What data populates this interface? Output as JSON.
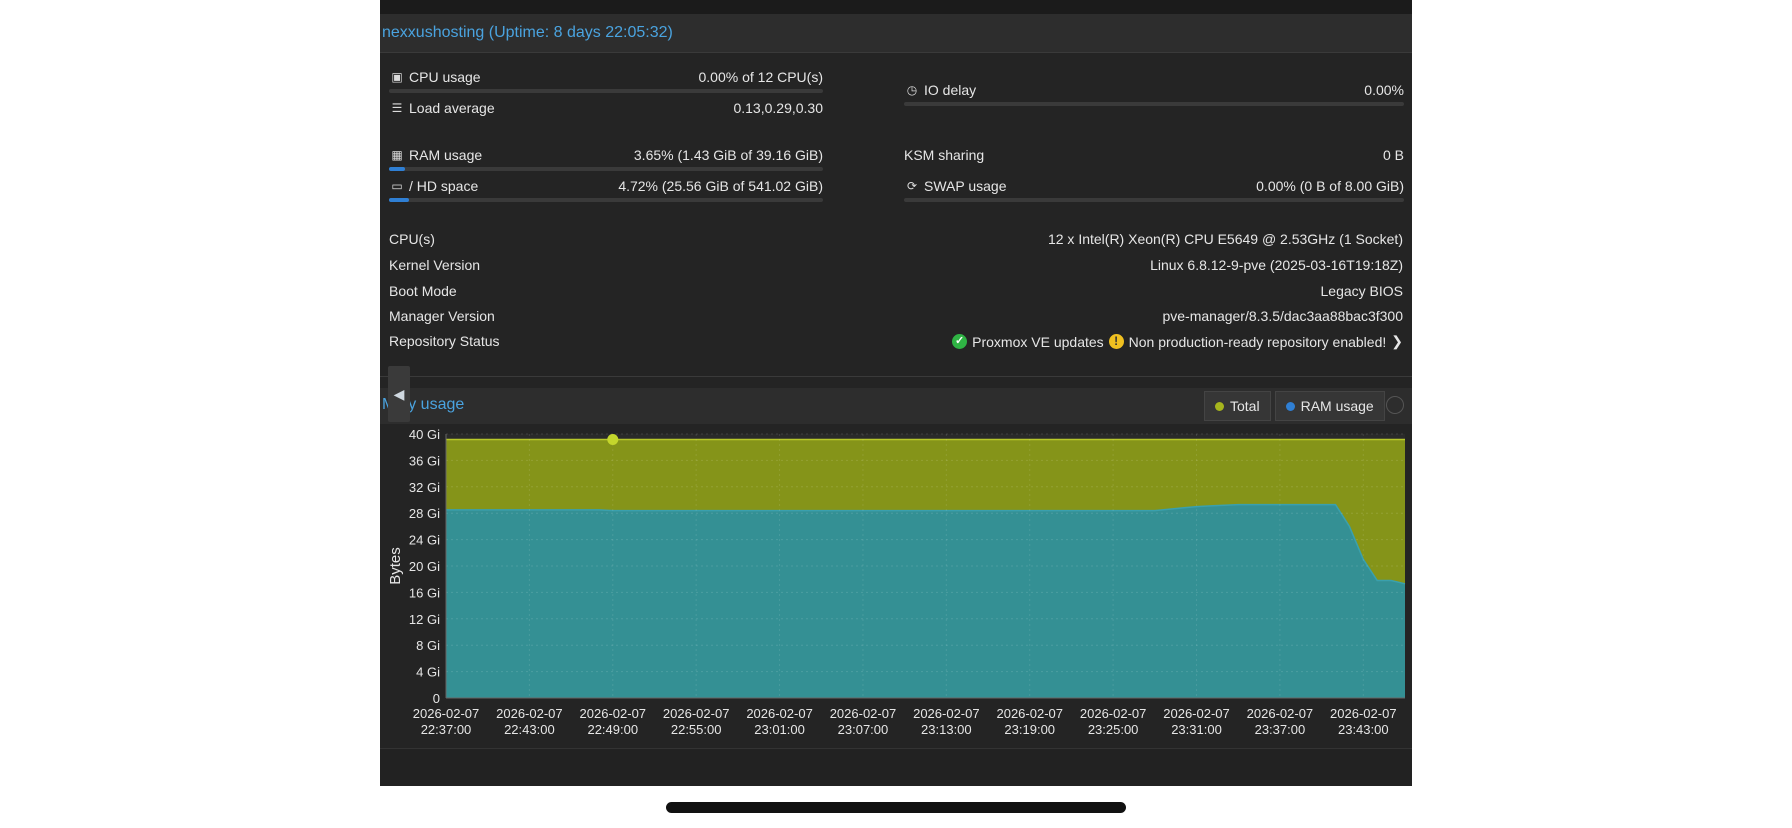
{
  "header": {
    "title": "nexxushosting (Uptime: 8 days 22:05:32)"
  },
  "metrics": {
    "cpu": {
      "label": "CPU usage",
      "value": "0.00% of 12 CPU(s)",
      "percent": 0.0,
      "icon": "cpu-icon"
    },
    "io": {
      "label": "IO delay",
      "value": "0.00%",
      "percent": 0.0,
      "icon": "clock-icon"
    },
    "load": {
      "label": "Load average",
      "value": "0.13,0.29,0.30",
      "icon": "list-icon"
    },
    "ram": {
      "label": "RAM usage",
      "value": "3.65% (1.43 GiB of 39.16 GiB)",
      "percent": 3.65,
      "icon": "memory-icon"
    },
    "ksm": {
      "label": "KSM sharing",
      "value": "0 B"
    },
    "hd": {
      "label": "/ HD space",
      "value": "4.72% (25.56 GiB of 541.02 GiB)",
      "percent": 4.72,
      "icon": "hdd-icon"
    },
    "swap": {
      "label": "SWAP usage",
      "value": "0.00% (0 B of 8.00 GiB)",
      "percent": 0.0,
      "icon": "refresh-icon"
    }
  },
  "info": [
    {
      "key": "CPU(s)",
      "value": "12 x Intel(R) Xeon(R) CPU E5649 @ 2.53GHz (1 Socket)"
    },
    {
      "key": "Kernel Version",
      "value": "Linux 6.8.12-9-pve (2025-03-16T19:18Z)"
    },
    {
      "key": "Boot Mode",
      "value": "Legacy BIOS"
    },
    {
      "key": "Manager Version",
      "value": "pve-manager/8.3.5/dac3aa88bac3f300"
    }
  ],
  "repo": {
    "key": "Repository Status",
    "ok_text": "Proxmox VE updates",
    "warn_text": "Non production-ready repository enabled!"
  },
  "memory": {
    "title": "ory usage",
    "title_initial": "M",
    "legend": [
      {
        "name": "Total",
        "color": "#a6b51d"
      },
      {
        "name": "RAM usage",
        "color": "#2f7fd4"
      }
    ]
  },
  "colors": {
    "accent": "#4aa3df",
    "total_fill": "#8a9a18",
    "ram_fill": "#2f8f9b",
    "bar_fill": "#2f7fd4"
  },
  "chart_data": {
    "type": "area",
    "ylabel": "Bytes",
    "ylim": [
      0,
      40
    ],
    "yticks": [
      "0",
      "4 Gi",
      "8 Gi",
      "12 Gi",
      "16 Gi",
      "20 Gi",
      "24 Gi",
      "28 Gi",
      "32 Gi",
      "36 Gi",
      "40 Gi"
    ],
    "yvalues": [
      0,
      4,
      8,
      12,
      16,
      20,
      24,
      28,
      32,
      36,
      40
    ],
    "x": [
      "2026-02-07 22:37:00",
      "2026-02-07 22:38:00",
      "2026-02-07 22:39:00",
      "2026-02-07 22:40:00",
      "2026-02-07 22:41:00",
      "2026-02-07 22:42:00",
      "2026-02-07 22:43:00",
      "2026-02-07 22:44:00",
      "2026-02-07 22:45:00",
      "2026-02-07 22:46:00",
      "2026-02-07 22:47:00",
      "2026-02-07 22:48:00",
      "2026-02-07 22:49:00",
      "2026-02-07 22:50:00",
      "2026-02-07 22:51:00",
      "2026-02-07 22:52:00",
      "2026-02-07 22:53:00",
      "2026-02-07 22:54:00",
      "2026-02-07 22:55:00",
      "2026-02-07 22:56:00",
      "2026-02-07 22:57:00",
      "2026-02-07 22:58:00",
      "2026-02-07 22:59:00",
      "2026-02-07 23:00:00",
      "2026-02-07 23:01:00",
      "2026-02-07 23:02:00",
      "2026-02-07 23:03:00",
      "2026-02-07 23:04:00",
      "2026-02-07 23:05:00",
      "2026-02-07 23:06:00",
      "2026-02-07 23:07:00",
      "2026-02-07 23:08:00",
      "2026-02-07 23:09:00",
      "2026-02-07 23:10:00",
      "2026-02-07 23:11:00",
      "2026-02-07 23:12:00",
      "2026-02-07 23:13:00",
      "2026-02-07 23:14:00",
      "2026-02-07 23:15:00",
      "2026-02-07 23:16:00",
      "2026-02-07 23:17:00",
      "2026-02-07 23:18:00",
      "2026-02-07 23:19:00",
      "2026-02-07 23:20:00",
      "2026-02-07 23:21:00",
      "2026-02-07 23:22:00",
      "2026-02-07 23:23:00",
      "2026-02-07 23:24:00",
      "2026-02-07 23:25:00",
      "2026-02-07 23:26:00",
      "2026-02-07 23:27:00",
      "2026-02-07 23:28:00",
      "2026-02-07 23:29:00",
      "2026-02-07 23:30:00",
      "2026-02-07 23:31:00",
      "2026-02-07 23:32:00",
      "2026-02-07 23:33:00",
      "2026-02-07 23:34:00",
      "2026-02-07 23:35:00",
      "2026-02-07 23:36:00",
      "2026-02-07 23:37:00",
      "2026-02-07 23:38:00",
      "2026-02-07 23:39:00",
      "2026-02-07 23:40:00",
      "2026-02-07 23:41:00",
      "2026-02-07 23:42:00",
      "2026-02-07 23:43:00",
      "2026-02-07 23:44:00",
      "2026-02-07 23:45:00",
      "2026-02-07 23:46:00"
    ],
    "xtick_labels": [
      [
        "2026-02-07",
        "22:37:00"
      ],
      [
        "2026-02-07",
        "22:43:00"
      ],
      [
        "2026-02-07",
        "22:49:00"
      ],
      [
        "2026-02-07",
        "22:55:00"
      ],
      [
        "2026-02-07",
        "23:01:00"
      ],
      [
        "2026-02-07",
        "23:07:00"
      ],
      [
        "2026-02-07",
        "23:13:00"
      ],
      [
        "2026-02-07",
        "23:19:00"
      ],
      [
        "2026-02-07",
        "23:25:00"
      ],
      [
        "2026-02-07",
        "23:31:00"
      ],
      [
        "2026-02-07",
        "23:37:00"
      ],
      [
        "2026-02-07",
        "23:43:00"
      ]
    ],
    "series": [
      {
        "name": "Total",
        "values": [
          39.16,
          39.16,
          39.16,
          39.16,
          39.16,
          39.16,
          39.16,
          39.16,
          39.16,
          39.16,
          39.16,
          39.16,
          39.16,
          39.16,
          39.16,
          39.16,
          39.16,
          39.16,
          39.16,
          39.16,
          39.16,
          39.16,
          39.16,
          39.16,
          39.16,
          39.16,
          39.16,
          39.16,
          39.16,
          39.16,
          39.16,
          39.16,
          39.16,
          39.16,
          39.16,
          39.16,
          39.16,
          39.16,
          39.16,
          39.16,
          39.16,
          39.16,
          39.16,
          39.16,
          39.16,
          39.16,
          39.16,
          39.16,
          39.16,
          39.16,
          39.16,
          39.16,
          39.16,
          39.16,
          39.16,
          39.16,
          39.16,
          39.16,
          39.16,
          39.16,
          39.16,
          39.16,
          39.16,
          39.16,
          39.16,
          39.16,
          39.16,
          39.16,
          39.16,
          39.16
        ]
      },
      {
        "name": "RAM usage",
        "values": [
          28.5,
          28.5,
          28.5,
          28.5,
          28.5,
          28.5,
          28.5,
          28.5,
          28.5,
          28.5,
          28.5,
          28.5,
          28.4,
          28.4,
          28.4,
          28.4,
          28.4,
          28.4,
          28.4,
          28.4,
          28.4,
          28.4,
          28.4,
          28.4,
          28.4,
          28.4,
          28.4,
          28.4,
          28.4,
          28.4,
          28.4,
          28.4,
          28.4,
          28.4,
          28.4,
          28.4,
          28.4,
          28.4,
          28.4,
          28.4,
          28.4,
          28.4,
          28.4,
          28.4,
          28.4,
          28.4,
          28.4,
          28.4,
          28.4,
          28.4,
          28.4,
          28.4,
          28.6,
          28.8,
          29.0,
          29.1,
          29.2,
          29.3,
          29.3,
          29.3,
          29.3,
          29.3,
          29.3,
          29.3,
          29.3,
          26.0,
          21.0,
          17.8,
          17.8,
          17.3
        ]
      }
    ],
    "marker": {
      "series": "Total",
      "index": 12
    },
    "grid": true
  }
}
